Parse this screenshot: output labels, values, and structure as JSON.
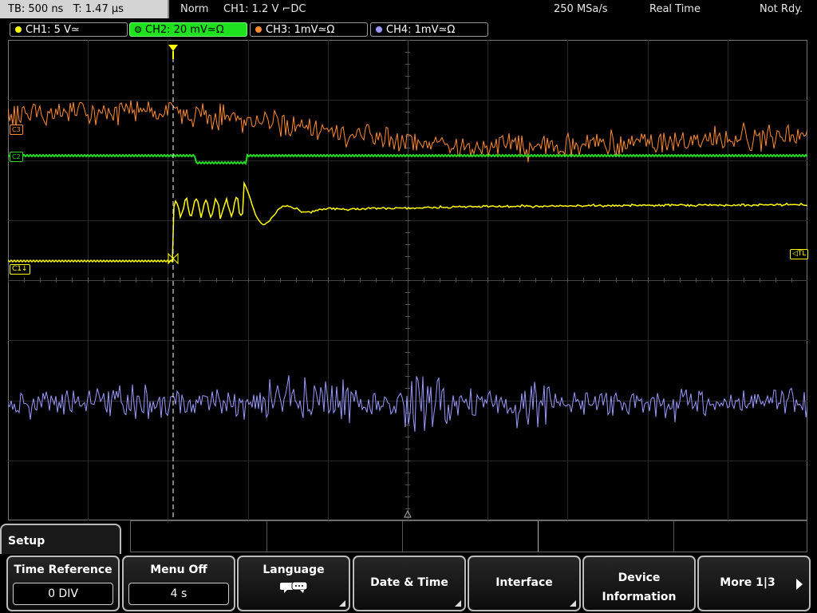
{
  "topbar": {
    "timebase": "TB: 500 ns",
    "trigger_time": "T: 1.47 µs",
    "mode": "Norm",
    "trigger": "CH1: 1.2 V ⌐DC",
    "sample_rate": "250 MSa/s",
    "acq_mode": "Real Time",
    "status": "Not Rdy."
  },
  "channels": [
    {
      "label": "CH1: 5 V≃",
      "color": "#ffff00"
    },
    {
      "label": "CH2: 20 mV≃Ω",
      "color": "#00ff00"
    },
    {
      "label": "CH3: 1mV≃Ω",
      "color": "#ff8c30"
    },
    {
      "label": "CH4: 1mV≃Ω",
      "color": "#9898ff"
    }
  ],
  "waveform_markers": {
    "ch1": "C1",
    "ch2": "C2",
    "ch3": "C3",
    "trigger_level": "TL"
  },
  "menu": {
    "title": "Setup",
    "keys": [
      {
        "label": "Time Reference",
        "value": "0 DIV"
      },
      {
        "label": "Menu Off",
        "value": "4 s"
      },
      {
        "label": "Language",
        "icon": "speech-bubbles-icon"
      },
      {
        "label": "Date & Time"
      },
      {
        "label": "Interface"
      },
      {
        "label1": "Device",
        "label2": "Information"
      },
      {
        "label": "More 1|3"
      }
    ]
  }
}
